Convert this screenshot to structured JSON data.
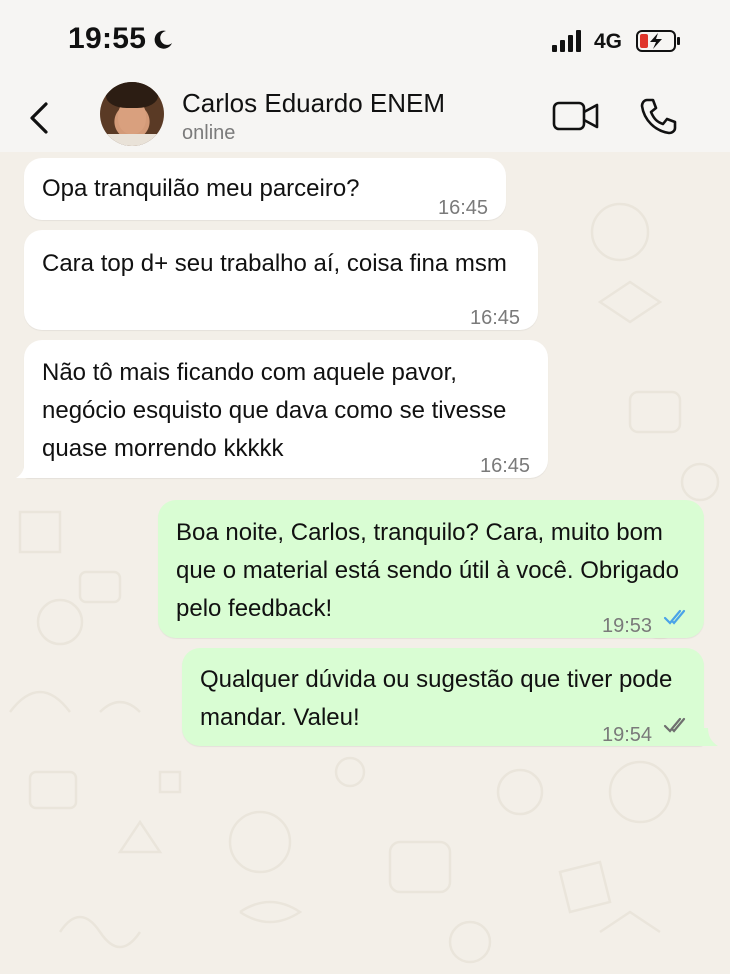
{
  "status_bar": {
    "time": "19:55",
    "network": "4G"
  },
  "header": {
    "contact_name": "Carlos Eduardo ENEM",
    "contact_status": "online"
  },
  "messages": [
    {
      "direction": "incoming",
      "text": "Opa tranquilão meu parceiro?",
      "time": "16:45"
    },
    {
      "direction": "incoming",
      "text": "Cara top d+ seu trabalho aí, coisa fina msm",
      "time": "16:45"
    },
    {
      "direction": "incoming",
      "text": "Não tô mais ficando com aquele pavor, negócio esquisto que dava como se tivesse quase morrendo kkkkk",
      "time": "16:45"
    },
    {
      "direction": "outgoing",
      "text": "Boa noite, Carlos, tranquilo? Cara, muito bom que o material está sendo útil à você. Obrigado pelo feedback!",
      "time": "19:53",
      "status": "read"
    },
    {
      "direction": "outgoing",
      "text": "Qualquer dúvida ou sugestão que tiver pode mandar. Valeu!",
      "time": "19:54",
      "status": "delivered"
    }
  ],
  "colors": {
    "incoming_bubble": "#ffffff",
    "outgoing_bubble": "#d9fdd3",
    "read_ticks": "#4aa3e8",
    "delivered_ticks": "#6f6f6f",
    "chat_background": "#f3efe8"
  },
  "icons": {
    "back": "chevron-left-icon",
    "moon": "moon-icon",
    "signal": "cellular-signal-icon",
    "battery": "battery-charging-icon",
    "video": "video-call-icon",
    "call": "phone-icon"
  }
}
